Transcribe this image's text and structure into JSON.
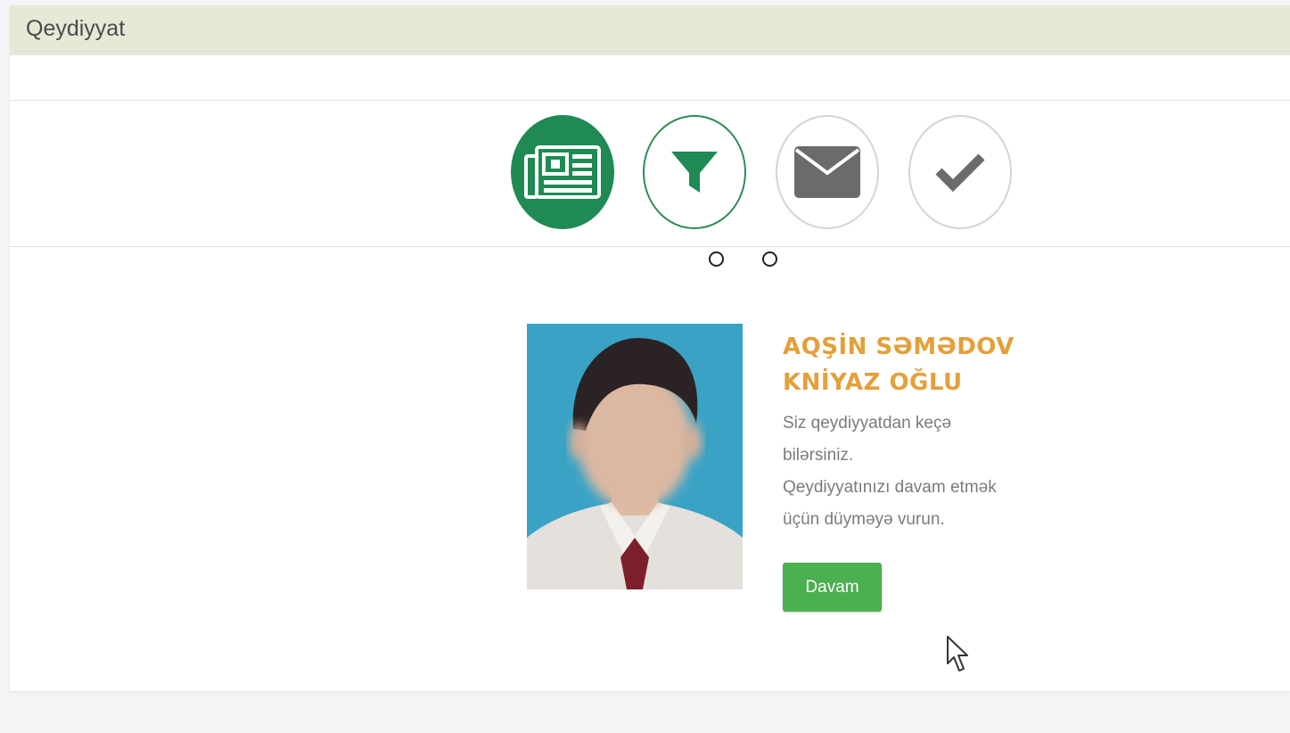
{
  "panel": {
    "title": "Qeydiyyat"
  },
  "steps": [
    {
      "icon": "newspaper-icon",
      "state": "completed"
    },
    {
      "icon": "filter-icon",
      "state": "active"
    },
    {
      "icon": "envelope-icon",
      "state": "pending"
    },
    {
      "icon": "check-icon",
      "state": "pending"
    }
  ],
  "profile": {
    "name_line1": "AQŞİN SƏMƏDOV",
    "name_line2": "KNİYAZ OĞLU",
    "message_line1": "Siz qeydiyyatdan keçə",
    "message_line2": "bilərsiniz.",
    "message_line3": "Qeydiyyatınızı davam etmək",
    "message_line4": "üçün düyməyə vurun.",
    "button_label": "Davam"
  },
  "colors": {
    "header_bg": "#e5ead7",
    "step_active": "#1f8a54",
    "name": "#e3a03b",
    "button": "#4caf50",
    "photo_bg": "#3aa3c5"
  }
}
